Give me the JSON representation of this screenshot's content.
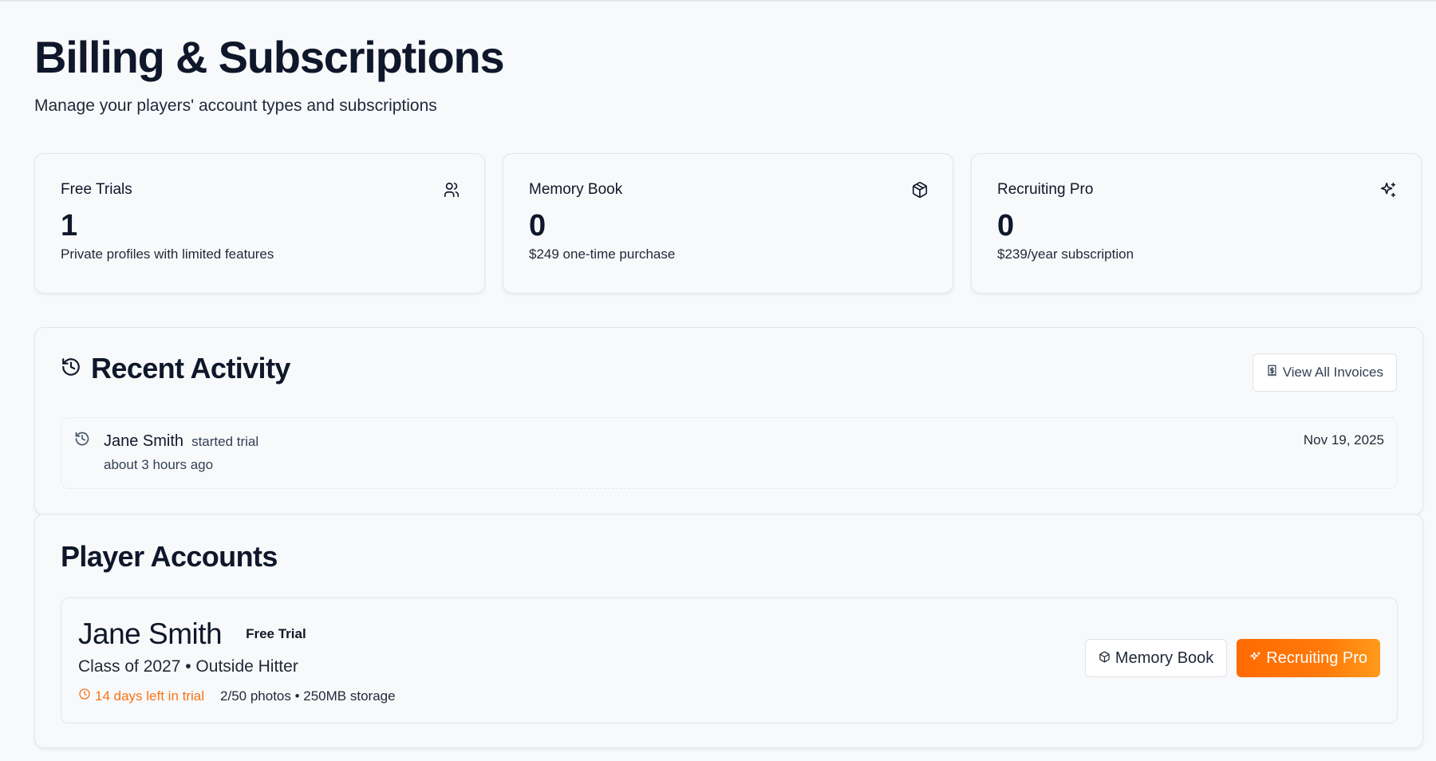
{
  "header": {
    "title": "Billing & Subscriptions",
    "subtitle": "Manage your players' account types and subscriptions"
  },
  "stats": [
    {
      "label": "Free Trials",
      "value": "1",
      "description": "Private profiles with limited features",
      "icon": "users-icon"
    },
    {
      "label": "Memory Book",
      "value": "0",
      "description": "$249 one-time purchase",
      "icon": "package-icon"
    },
    {
      "label": "Recruiting Pro",
      "value": "0",
      "description": "$239/year subscription",
      "icon": "sparkles-icon"
    }
  ],
  "recent_activity": {
    "title": "Recent Activity",
    "view_invoices_label": "View All Invoices",
    "items": [
      {
        "name": "Jane Smith",
        "action": "started trial",
        "relative_time": "about 3 hours ago",
        "date": "Nov 19, 2025"
      }
    ]
  },
  "player_accounts": {
    "title": "Player Accounts",
    "accounts": [
      {
        "name": "Jane Smith",
        "badge": "Free Trial",
        "meta": "Class of 2027 • Outside Hitter",
        "trial_left": "14 days left in trial",
        "usage": "2/50 photos • 250MB storage",
        "memory_book_label": "Memory Book",
        "recruiting_pro_label": "Recruiting Pro"
      }
    ]
  },
  "colors": {
    "accent_orange": "#ff6a00",
    "trial_warning": "#f97316",
    "text_primary": "#0f172a"
  }
}
